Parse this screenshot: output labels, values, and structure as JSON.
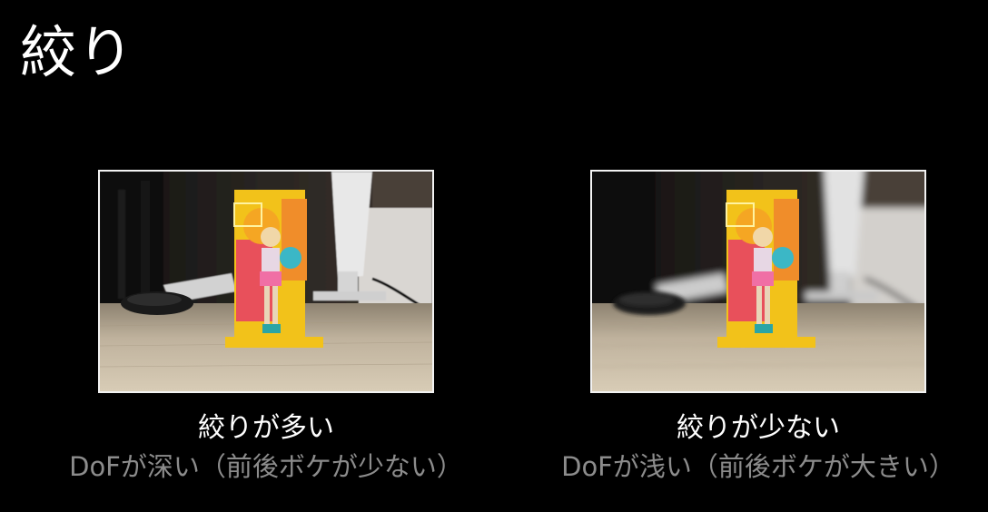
{
  "slide": {
    "title": "絞り",
    "background_color": "#000000"
  },
  "panels": [
    {
      "image_subject": "figure-on-desk-photo",
      "background_blur": "low",
      "caption_main": "絞りが多い",
      "caption_sub": "DoFが深い（前後ボケが少ない）"
    },
    {
      "image_subject": "figure-on-desk-photo",
      "background_blur": "high",
      "caption_main": "絞りが少ない",
      "caption_sub": "DoFが浅い（前後ボケが大きい）"
    }
  ],
  "colors": {
    "caption_main": "#ffffff",
    "caption_sub": "#8c8c8c",
    "photo_border": "#f2f2f2"
  }
}
